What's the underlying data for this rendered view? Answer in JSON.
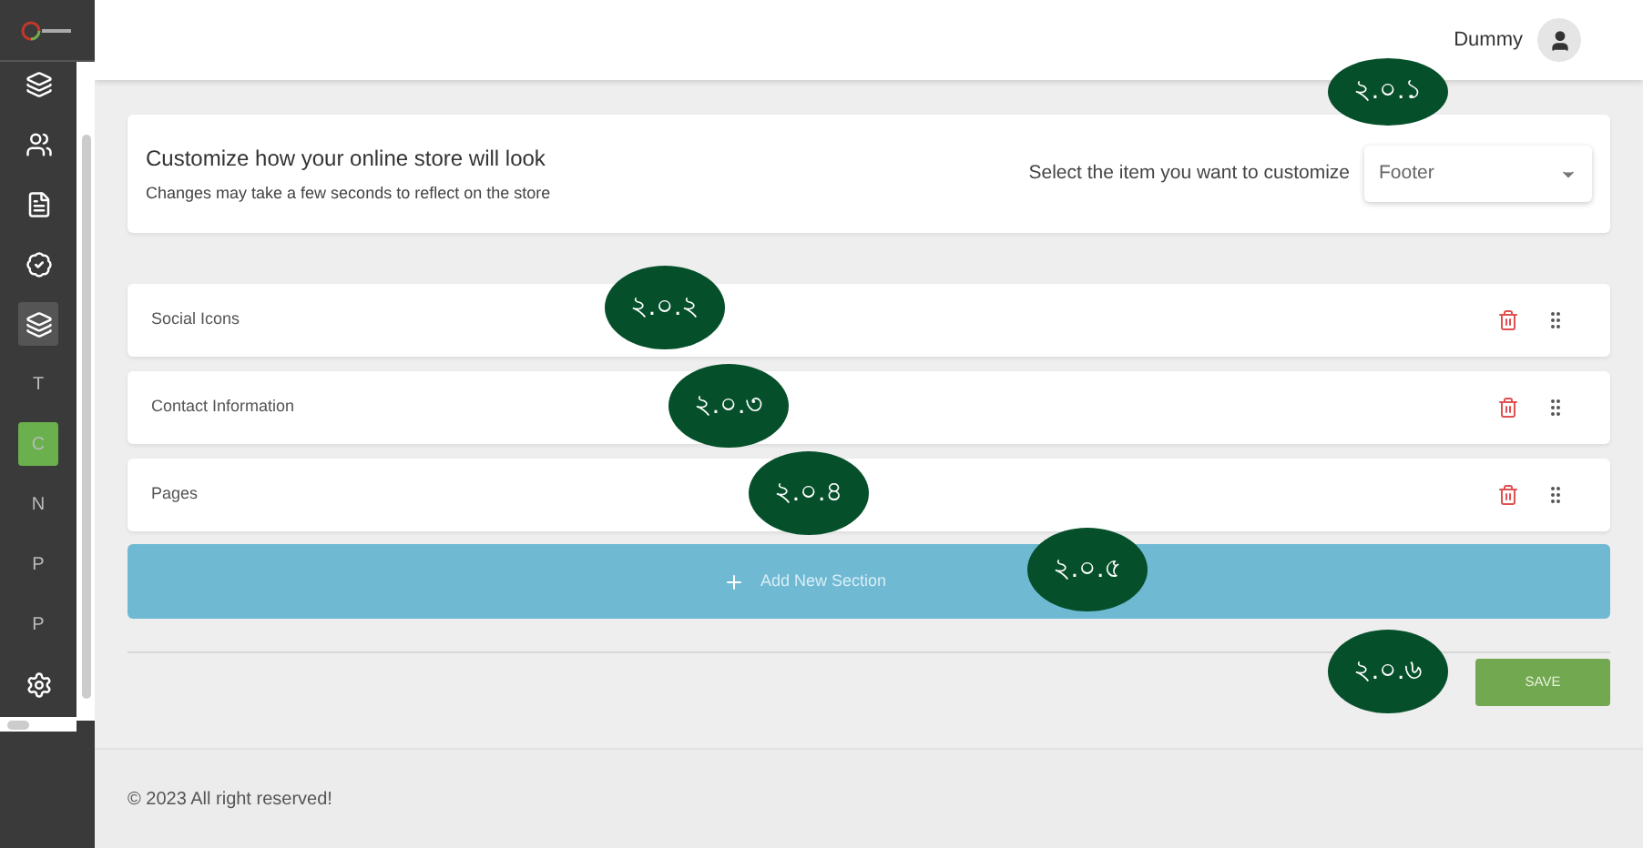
{
  "sidebar": {
    "items": [
      {
        "kind": "icon",
        "selected": false
      },
      {
        "kind": "icon",
        "selected": false
      },
      {
        "kind": "icon",
        "selected": false
      },
      {
        "kind": "icon",
        "selected": false
      },
      {
        "kind": "icon",
        "selected": true
      },
      {
        "kind": "letter",
        "label": "T",
        "selected": false
      },
      {
        "kind": "letter",
        "label": "C",
        "selected": true
      },
      {
        "kind": "letter",
        "label": "N",
        "selected": false
      },
      {
        "kind": "letter",
        "label": "P",
        "selected": false
      },
      {
        "kind": "letter",
        "label": "P",
        "selected": false
      },
      {
        "kind": "icon",
        "selected": false
      }
    ]
  },
  "header": {
    "user": "Dummy"
  },
  "customize": {
    "title": "Customize how your online store will look",
    "subtitle": "Changes may take a few seconds to reflect on the store",
    "select_label": "Select the item you want to customize",
    "select_value": "Footer",
    "marker": "২.০.১"
  },
  "sections": [
    {
      "name": "Social Icons",
      "marker": "২.০.২"
    },
    {
      "name": "Contact Information",
      "marker": "২.০.৩"
    },
    {
      "name": "Pages",
      "marker": "২.০.৪"
    }
  ],
  "add_section": {
    "label": "Add New Section",
    "marker": "২.০.৫"
  },
  "save": {
    "label": "SAVE",
    "marker": "২.০.৬"
  },
  "footer": "© 2023 All right reserved!"
}
